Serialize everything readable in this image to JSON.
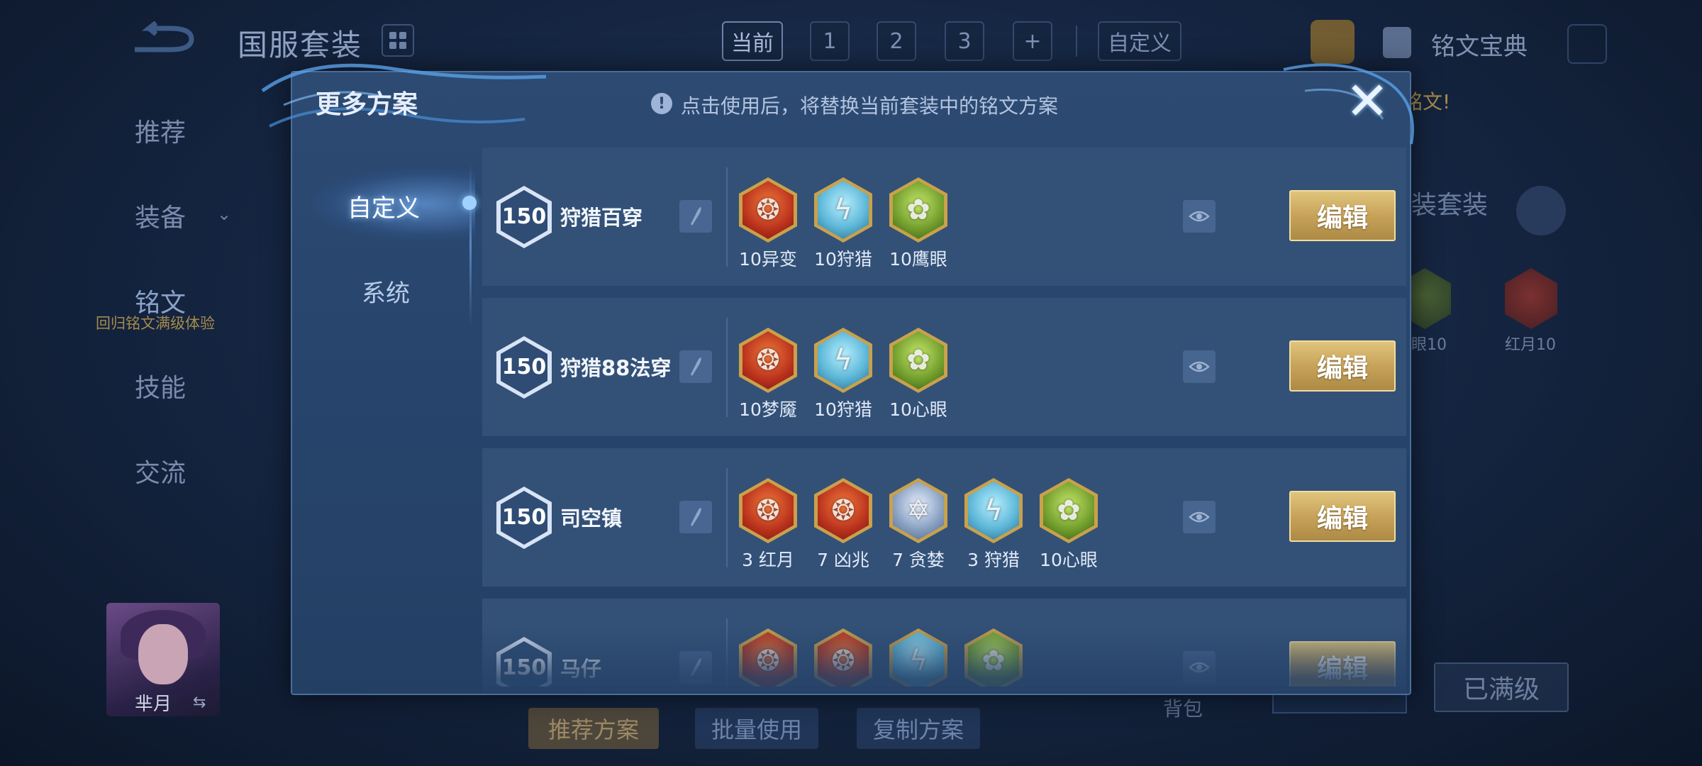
{
  "background": {
    "page_title": "国服套装",
    "top_tabs": [
      "当前",
      "1",
      "2",
      "3",
      "+"
    ],
    "custom_tab": "自定义",
    "codex_label": "铭文宝典",
    "nav": [
      "推荐",
      "装备",
      "铭文",
      "技能",
      "交流"
    ],
    "nav_sub": "回归铭文满级体验",
    "hero_name": "芈月",
    "bottom_buttons": [
      "推荐方案",
      "批量使用",
      "复制方案"
    ],
    "bag_label": "背包",
    "maxed_label": "已满级",
    "side_warn": "铭文!",
    "side_word": "装套装",
    "side_labels": [
      "眼10",
      "红月10"
    ]
  },
  "modal": {
    "title": "更多方案",
    "info_icon": "!",
    "info_text": "点击使用后，将替换当前套装中的铭文方案",
    "close_icon": "✕",
    "tabs": [
      "自定义",
      "系统"
    ],
    "edit_label": "编辑",
    "plans": [
      {
        "level": "150",
        "name": "狩猎百穿",
        "runes": [
          {
            "count": "10异变",
            "color": "red"
          },
          {
            "count": "10狩猎",
            "color": "blue"
          },
          {
            "count": "10鹰眼",
            "color": "green"
          }
        ]
      },
      {
        "level": "150",
        "name": "狩猎88法穿",
        "runes": [
          {
            "count": "10梦魇",
            "color": "red"
          },
          {
            "count": "10狩猎",
            "color": "blue"
          },
          {
            "count": "10心眼",
            "color": "green"
          }
        ]
      },
      {
        "level": "150",
        "name": "司空镇",
        "runes": [
          {
            "count": "3 红月",
            "color": "red"
          },
          {
            "count": "7 凶兆",
            "color": "red"
          },
          {
            "count": "7 贪婪",
            "color": "silver"
          },
          {
            "count": "3 狩猎",
            "color": "blue"
          },
          {
            "count": "10心眼",
            "color": "green"
          }
        ]
      },
      {
        "level": "150",
        "name": "马仔",
        "runes": [
          {
            "count": "",
            "color": "red"
          },
          {
            "count": "",
            "color": "red"
          },
          {
            "count": "",
            "color": "blue"
          },
          {
            "count": "",
            "color": "green"
          }
        ]
      }
    ]
  }
}
